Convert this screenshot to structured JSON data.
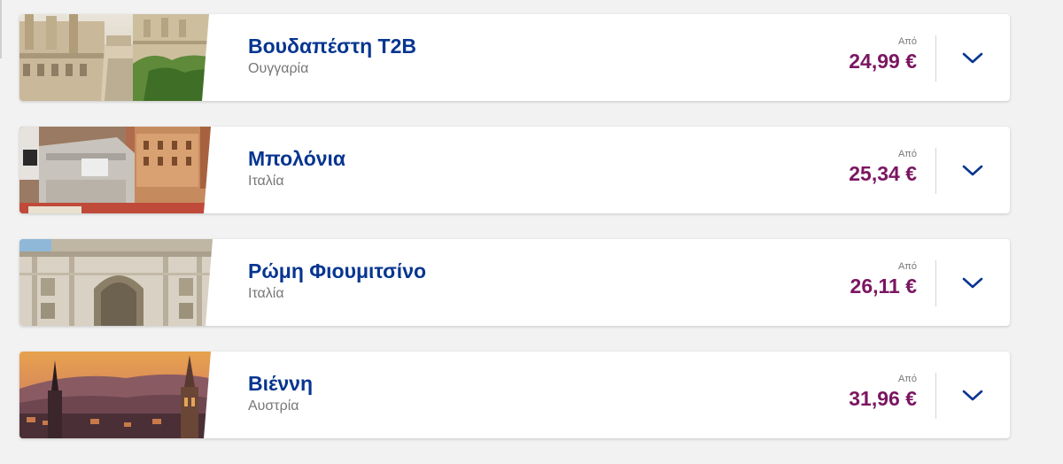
{
  "destinations": [
    {
      "city": "Βουδαπέστη T2B",
      "country": "Ουγγαρία",
      "from_label": "Από",
      "price": "24,99 €",
      "image": "budapest-fishermans-bastion-photo"
    },
    {
      "city": "Μπολόνια",
      "country": "Ιταλία",
      "from_label": "Από",
      "price": "25,34 €",
      "image": "bologna-piazza-photo"
    },
    {
      "city": "Ρώμη Φιουμιτσίνο",
      "country": "Ιταλία",
      "from_label": "Από",
      "price": "26,11 €",
      "image": "rome-trevi-fountain-photo"
    },
    {
      "city": "Βιέννη",
      "country": "Αυστρία",
      "from_label": "Από",
      "price": "31,96 €",
      "image": "vienna-sunset-skyline-photo"
    }
  ],
  "colors": {
    "city": "#073590",
    "price": "#7b1661",
    "chevron": "#073590",
    "muted": "#777777"
  },
  "icons": {
    "expand": "chevron-down-icon"
  }
}
